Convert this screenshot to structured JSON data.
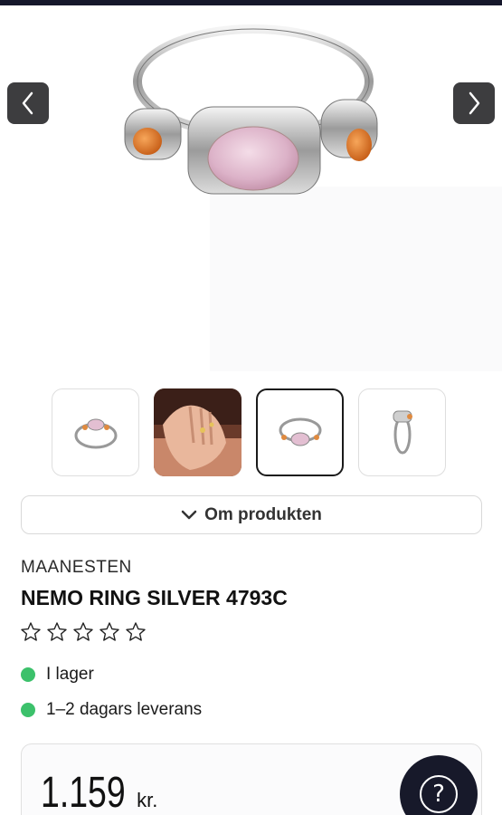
{
  "gallery": {
    "prev_icon": "chevron-left-icon",
    "next_icon": "chevron-right-icon",
    "thumbnail_count": 4,
    "active_thumbnail": 3
  },
  "about": {
    "label": "Om produkten",
    "icon": "chevron-down-icon"
  },
  "product": {
    "brand": "MAANESTEN",
    "title": "NEMO RING SILVER 4793C",
    "rating_stars": 0,
    "rating_max": 5
  },
  "stock": [
    {
      "label": "I lager",
      "color": "#3cc16b"
    },
    {
      "label": "1–2 dagars leverans",
      "color": "#3cc16b"
    }
  ],
  "price": {
    "amount": "1.159",
    "currency": "kr."
  },
  "help": {
    "glyph": "?"
  },
  "colors": {
    "topbar": "#15172b",
    "help_button": "#17192a",
    "nav_button": "#3d3d3f"
  }
}
